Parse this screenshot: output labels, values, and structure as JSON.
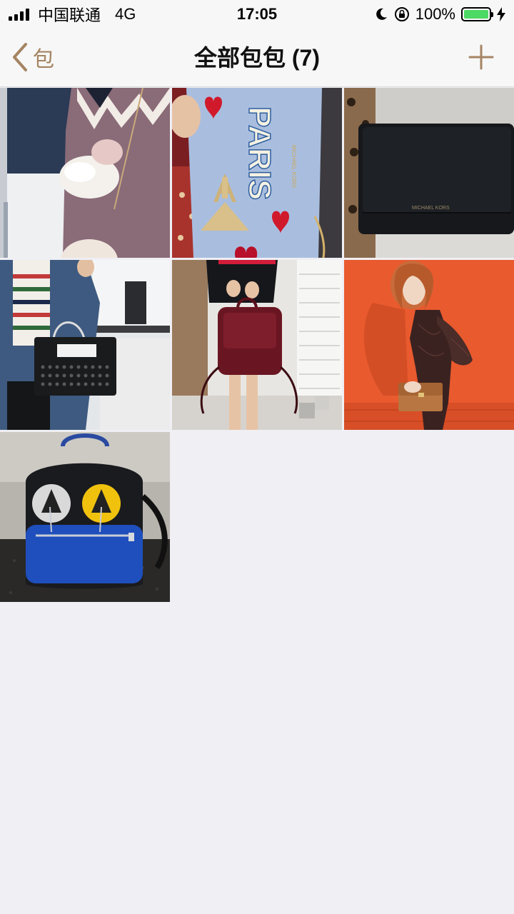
{
  "status_bar": {
    "carrier": "中国联通",
    "network": "4G",
    "time": "17:05",
    "battery": "100%",
    "battery_level": 1.0
  },
  "nav": {
    "back_label": "包",
    "title": "全部包包 (7)",
    "accent_color": "#a58462"
  },
  "photos": [
    {
      "id": "photo-1",
      "subject": "white-fur-pouch"
    },
    {
      "id": "photo-2",
      "subject": "paris-wallet",
      "print_text": "PARIS"
    },
    {
      "id": "photo-3",
      "subject": "black-crossbody"
    },
    {
      "id": "photo-4",
      "subject": "black-studded-tote"
    },
    {
      "id": "photo-5",
      "subject": "burgundy-backpack"
    },
    {
      "id": "photo-6",
      "subject": "tan-crossbody"
    },
    {
      "id": "photo-7",
      "subject": "monster-backpack"
    }
  ]
}
